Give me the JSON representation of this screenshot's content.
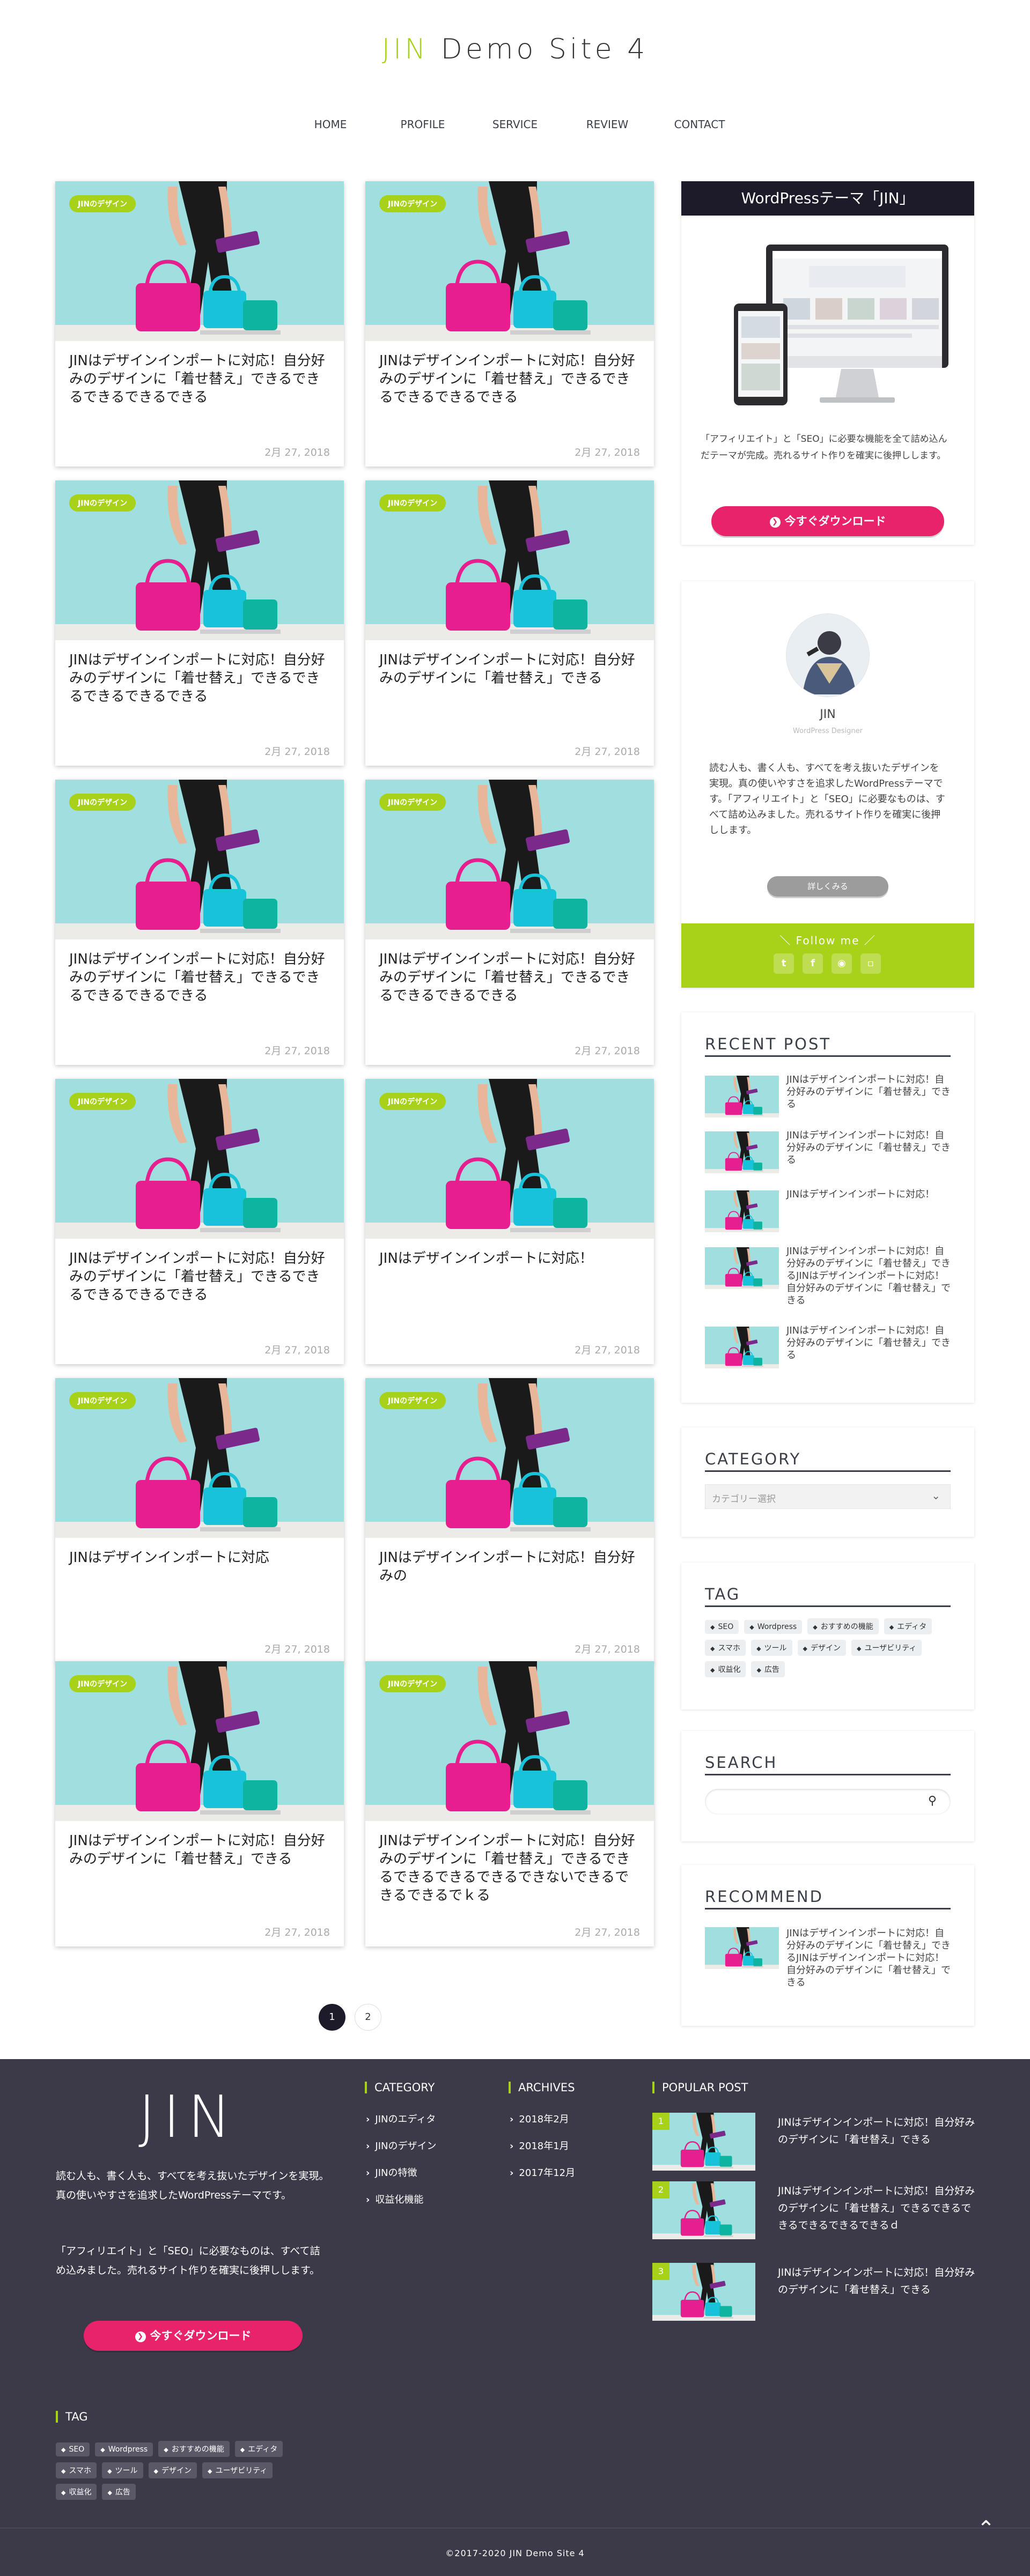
{
  "site": {
    "title_accent": "JIN",
    "title_rest": " Demo Site 4"
  },
  "nav": [
    "HOME",
    "PROFILE",
    "SERVICE",
    "REVIEW",
    "CONTACT"
  ],
  "posts": [
    {
      "cat": "JINのデザイン",
      "title": "JINはデザインインポートに対応！自分好みのデザインに「着せ替え」できるできるできるできるできる",
      "date": "2月 27, 2018"
    },
    {
      "cat": "JINのデザイン",
      "title": "JINはデザインインポートに対応！自分好みのデザインに「着せ替え」できるできるできるできるできる",
      "date": "2月 27, 2018"
    },
    {
      "cat": "JINのデザイン",
      "title": "JINはデザインインポートに対応！自分好みのデザインに「着せ替え」できるできるできるできるできる",
      "date": "2月 27, 2018"
    },
    {
      "cat": "JINのデザイン",
      "title": "JINはデザインインポートに対応！自分好みのデザインに「着せ替え」できる",
      "date": "2月 27, 2018"
    },
    {
      "cat": "JINのデザイン",
      "title": "JINはデザインインポートに対応！自分好みのデザインに「着せ替え」できるできるできるできるできる",
      "date": "2月 27, 2018"
    },
    {
      "cat": "JINのデザイン",
      "title": "JINはデザインインポートに対応！自分好みのデザインに「着せ替え」できるできるできるできるできる",
      "date": "2月 27, 2018"
    },
    {
      "cat": "JINのデザイン",
      "title": "JINはデザインインポートに対応！自分好みのデザインに「着せ替え」できるできるできるできるできる",
      "date": "2月 27, 2018"
    },
    {
      "cat": "JINのデザイン",
      "title": "JINはデザインインポートに対応！",
      "date": "2月 27, 2018"
    },
    {
      "cat": "JINのデザイン",
      "title": "JINはデザインインポートに対応",
      "date": "2月 27, 2018"
    },
    {
      "cat": "JINのデザイン",
      "title": "JINはデザインインポートに対応！自分好みの",
      "date": "2月 27, 2018"
    },
    {
      "cat": "JINのデザイン",
      "title": "JINはデザインインポートに対応！自分好みのデザインに「着せ替え」できる",
      "date": "2月 27, 2018"
    },
    {
      "cat": "JINのデザイン",
      "title": "JINはデザインインポートに対応！自分好みのデザインに「着せ替え」できるできるできるできるできるできないできるできるできるでｋる",
      "date": "2月 27, 2018"
    }
  ],
  "pagination": [
    "1",
    "2"
  ],
  "promo": {
    "heading": "WordPressテーマ「JIN」",
    "text": "「アフィリエイト」と「SEO」に必要な機能を全て詰め込んだテーマが完成。売れるサイト作りを確実に後押しします。",
    "button": "今すぐダウンロード"
  },
  "profile": {
    "name": "JIN",
    "sub": "WordPress Designer",
    "text": "読む人も、書く人も、すべてを考え抜いたデザインを実現。真の使いやすさを追求したWordPressテーマです。「アフィリエイト」と「SEO」に必要なものは、すべて詰め込みました。売れるサイト作りを確実に後押しします。",
    "button": "詳しくみる",
    "follow": "＼ Follow me ／",
    "icons": [
      "twitter-icon",
      "facebook-icon",
      "instagram-icon",
      "line-icon"
    ]
  },
  "recent": {
    "heading": "RECENT POST",
    "items": [
      "JINはデザインインポートに対応！自分好みのデザインに「着せ替え」できる",
      "JINはデザインインポートに対応！自分好みのデザインに「着せ替え」できる",
      "JINはデザインインポートに対応！",
      "JINはデザインインポートに対応！自分好みのデザインに「着せ替え」できるJINはデザインインポートに対応！自分好みのデザインに「着せ替え」できる",
      "JINはデザインインポートに対応！自分好みのデザインに「着せ替え」できる"
    ]
  },
  "category": {
    "heading": "CATEGORY",
    "placeholder": "カテゴリー選択"
  },
  "tagbox": {
    "heading": "TAG",
    "tags": [
      "SEO",
      "Wordpress",
      "おすすめの機能",
      "エディタ",
      "スマホ",
      "ツール",
      "デザイン",
      "ユーザビリティ",
      "収益化",
      "広告"
    ]
  },
  "search": {
    "heading": "SEARCH"
  },
  "recommend": {
    "heading": "RECOMMEND",
    "item": "JINはデザインインポートに対応！自分好みのデザインに「着せ替え」できるJINはデザインインポートに対応！自分好みのデザインに「着せ替え」できる"
  },
  "footer": {
    "logo": "JIN",
    "text1": "読む人も、書く人も、すべてを考え抜いたデザインを実現。真の使いやすさを追求したWordPressテーマです。",
    "text2": "「アフィリエイト」と「SEO」に必要なものは、すべて詰め込みました。売れるサイト作りを確実に後押しします。",
    "button": "今すぐダウンロード",
    "cat_head": "CATEGORY",
    "cats": [
      "JINのエディタ",
      "JINのデザイン",
      "JINの特徴",
      "収益化機能"
    ],
    "arch_head": "ARCHIVES",
    "archives": [
      "2018年2月",
      "2018年1月",
      "2017年12月"
    ],
    "pop_head": "POPULAR POST",
    "popular": [
      {
        "rank": "1",
        "title": "JINはデザインインポートに対応！自分好みのデザインに「着せ替え」できる"
      },
      {
        "rank": "2",
        "title": "JINはデザインインポートに対応！自分好みのデザインに「着せ替え」できるできるできるできるできるできるｄ"
      },
      {
        "rank": "3",
        "title": "JINはデザインインポートに対応！自分好みのデザインに「着せ替え」できる"
      }
    ],
    "tag_head": "TAG",
    "tags": [
      "SEO",
      "Wordpress",
      "おすすめの機能",
      "エディタ",
      "スマホ",
      "ツール",
      "デザイン",
      "ユーザビリティ",
      "収益化",
      "広告"
    ],
    "copyright": "©2017-2020 JIN Demo Site 4"
  },
  "colors": {
    "accent": "#a8d21a",
    "pink": "#e9236b",
    "footer_bg": "#3c3a48"
  }
}
